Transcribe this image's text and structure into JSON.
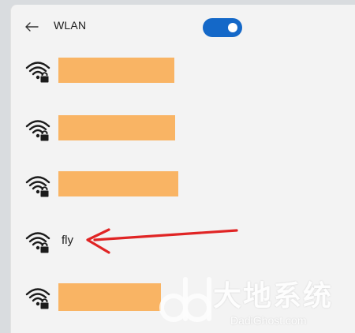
{
  "header": {
    "title": "WLAN",
    "back_icon": "back-arrow-icon",
    "toggle_on": true
  },
  "networks": [
    {
      "name": "",
      "redacted": true,
      "icon": "wifi-secured-icon"
    },
    {
      "name": "",
      "redacted": true,
      "icon": "wifi-secured-icon"
    },
    {
      "name": "",
      "redacted": true,
      "icon": "wifi-secured-icon"
    },
    {
      "name": "fly",
      "redacted": false,
      "icon": "wifi-secured-icon"
    },
    {
      "name": "",
      "redacted": true,
      "icon": "wifi-secured-icon"
    }
  ],
  "colors": {
    "accent": "#1468c8",
    "redaction": "#f9b464",
    "annotation_arrow": "#e02424"
  },
  "watermark": {
    "cn": "大地系统",
    "en": "DadiGhost.com"
  }
}
